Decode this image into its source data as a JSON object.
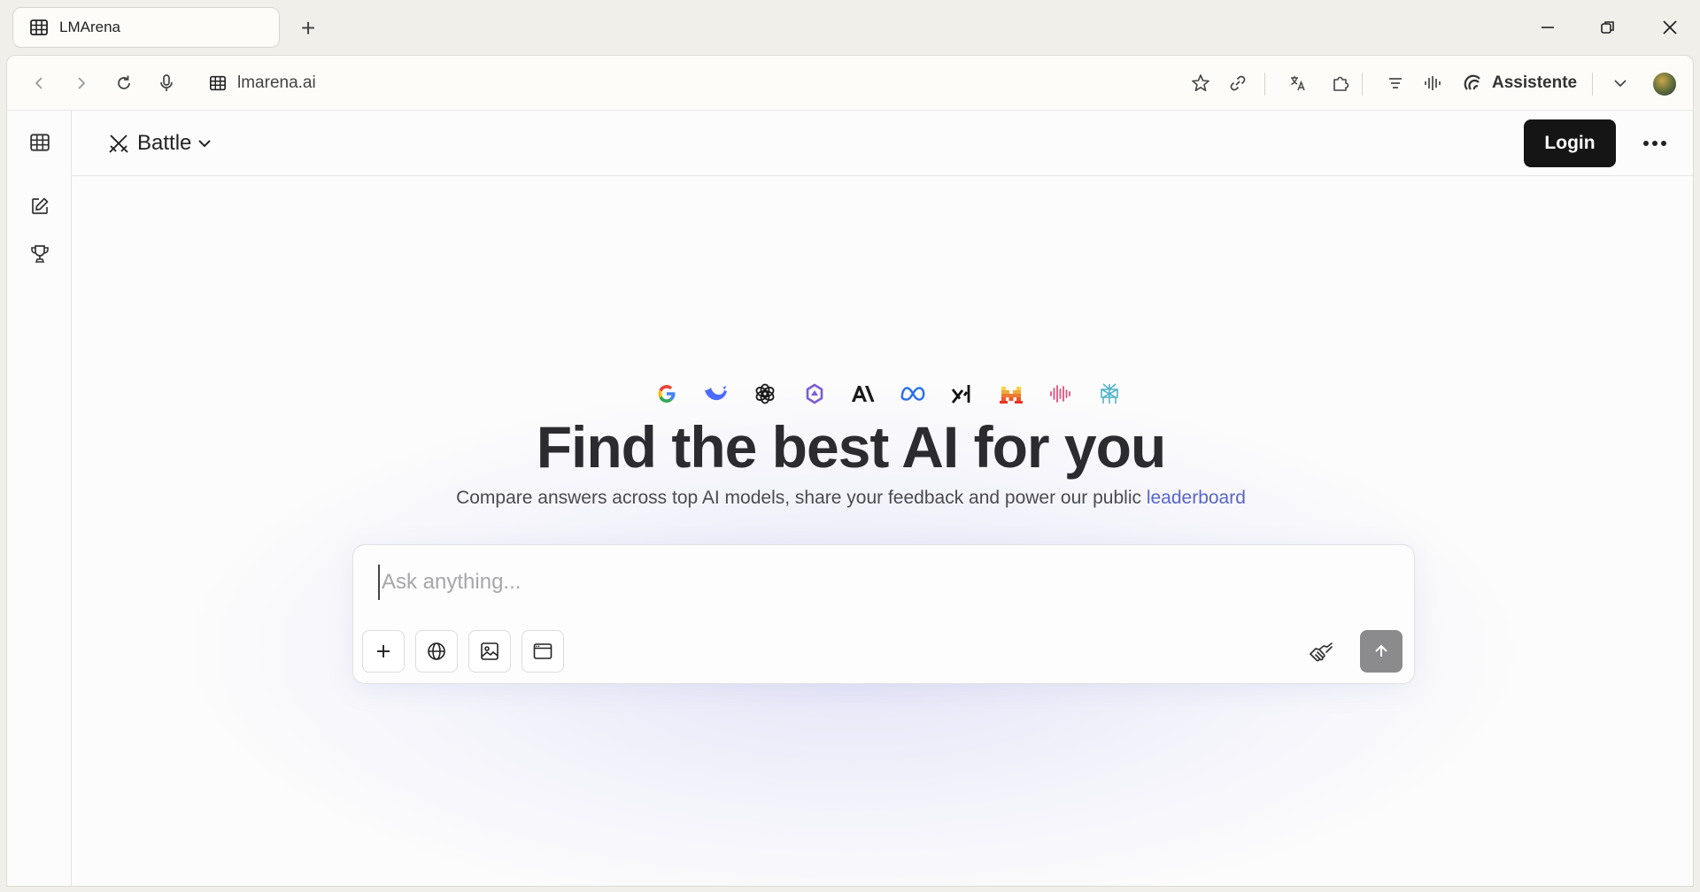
{
  "browser": {
    "tab": {
      "title": "LMArena",
      "favicon": "grid-icon"
    },
    "new_tab_symbol": "+",
    "address": {
      "url": "lmarena.ai"
    },
    "assistant_label": "Assistente",
    "toolbar_icons": [
      "back-icon",
      "forward-icon",
      "reload-icon",
      "mic-icon",
      "star-icon",
      "link-icon",
      "translate-icon",
      "extension-icon",
      "reader-icon",
      "audio-icon",
      "assistant-icon",
      "chevron-down-icon",
      "avatar"
    ]
  },
  "app": {
    "sidebar": {
      "items": [
        "grid-icon",
        "edit-icon",
        "trophy-icon"
      ]
    },
    "header": {
      "mode_label": "Battle",
      "login_label": "Login"
    },
    "hero": {
      "provider_logos": [
        "google",
        "deepseek",
        "openai",
        "gemini",
        "anthropic",
        "meta",
        "xai",
        "mistral",
        "audio-wave",
        "perplexity"
      ],
      "title": "Find the best AI for you",
      "subtitle": "Compare answers across top AI models, share your feedback and power our public",
      "subtitle_link": "leaderboard"
    },
    "composer": {
      "placeholder": "Ask anything...",
      "value": "",
      "tools": [
        "plus-icon",
        "globe-icon",
        "image-icon",
        "browser-window-icon"
      ]
    }
  },
  "colors": {
    "accent_link": "#5865c7",
    "login_bg": "#151515",
    "send_bg": "#8b8b8e"
  }
}
